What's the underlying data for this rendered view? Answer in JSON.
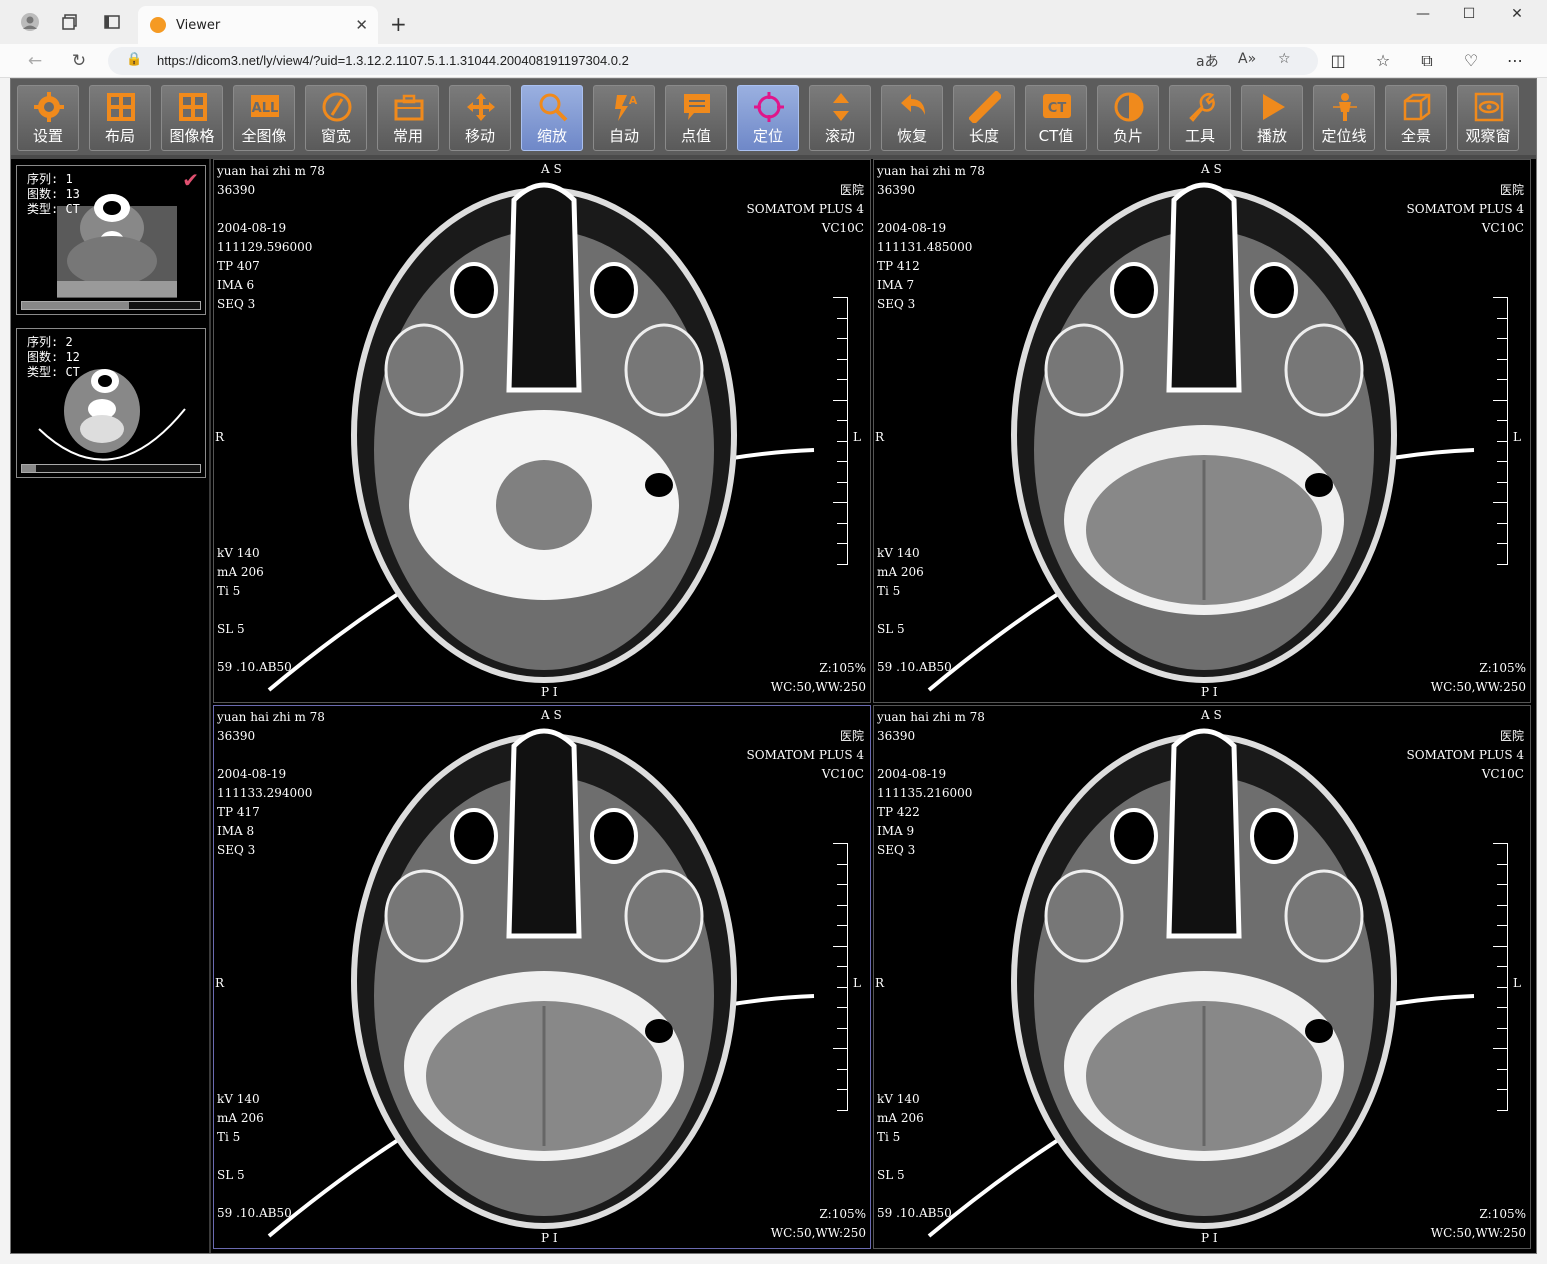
{
  "browser": {
    "tab_title": "Viewer",
    "url": "https://dicom3.net/ly/view4/?uid=1.3.12.2.1107.5.1.1.31044.200408191197304.0.2"
  },
  "toolbar": [
    {
      "label": "设置",
      "icon": "gear-icon"
    },
    {
      "label": "布局",
      "icon": "layout-grid-icon"
    },
    {
      "label": "图像格",
      "icon": "image-grid-icon"
    },
    {
      "label": "全图像",
      "icon": "all-images-icon"
    },
    {
      "label": "窗宽",
      "icon": "window-width-icon"
    },
    {
      "label": "常用",
      "icon": "toolbox-icon"
    },
    {
      "label": "移动",
      "icon": "move-icon"
    },
    {
      "label": "缩放",
      "icon": "zoom-icon",
      "active": true
    },
    {
      "label": "自动",
      "icon": "auto-icon"
    },
    {
      "label": "点值",
      "icon": "point-value-icon"
    },
    {
      "label": "定位",
      "icon": "crosshair-icon",
      "active": true
    },
    {
      "label": "滚动",
      "icon": "scroll-icon"
    },
    {
      "label": "恢复",
      "icon": "undo-icon"
    },
    {
      "label": "长度",
      "icon": "ruler-icon"
    },
    {
      "label": "CT值",
      "icon": "ct-value-icon"
    },
    {
      "label": "负片",
      "icon": "invert-icon"
    },
    {
      "label": "工具",
      "icon": "wrench-icon"
    },
    {
      "label": "播放",
      "icon": "play-icon"
    },
    {
      "label": "定位线",
      "icon": "reference-line-icon"
    },
    {
      "label": "全景",
      "icon": "cube-icon"
    },
    {
      "label": "观察窗",
      "icon": "eye-window-icon"
    }
  ],
  "series": [
    {
      "line1": "序列: 1",
      "line2": "图数: 13",
      "line3": "类型: CT",
      "progress": 0.6,
      "selected": true
    },
    {
      "line1": "序列: 2",
      "line2": "图数: 12",
      "line3": "类型: CT",
      "progress": 0.08,
      "selected": false
    }
  ],
  "viewports": [
    {
      "patient": "yuan hai zhi m 78",
      "id": "36390",
      "date": "2004-08-19",
      "time": "111129.596000",
      "tp": "TP 407",
      "ima": "IMA 6",
      "seq": "SEQ 3",
      "hospital": "医院",
      "scanner": "SOMATOM PLUS 4",
      "code": "VC10C",
      "kv": "kV 140",
      "ma": "mA 206",
      "ti": "Ti 5",
      "sl": "SL 5",
      "kernel": "59 .10.AB50",
      "zoom": "Z:105%",
      "window": "WC:50,WW:250",
      "top": "A S",
      "bottom": "P I",
      "left": "R",
      "right": "L"
    },
    {
      "patient": "yuan hai zhi m 78",
      "id": "36390",
      "date": "2004-08-19",
      "time": "111131.485000",
      "tp": "TP 412",
      "ima": "IMA 7",
      "seq": "SEQ 3",
      "hospital": "医院",
      "scanner": "SOMATOM PLUS 4",
      "code": "VC10C",
      "kv": "kV 140",
      "ma": "mA 206",
      "ti": "Ti 5",
      "sl": "SL 5",
      "kernel": "59 .10.AB50",
      "zoom": "Z:105%",
      "window": "WC:50,WW:250",
      "top": "A S",
      "bottom": "P I",
      "left": "R",
      "right": "L"
    },
    {
      "patient": "yuan hai zhi m 78",
      "id": "36390",
      "date": "2004-08-19",
      "time": "111133.294000",
      "tp": "TP 417",
      "ima": "IMA 8",
      "seq": "SEQ 3",
      "hospital": "医院",
      "scanner": "SOMATOM PLUS 4",
      "code": "VC10C",
      "kv": "kV 140",
      "ma": "mA 206",
      "ti": "Ti 5",
      "sl": "SL 5",
      "kernel": "59 .10.AB50",
      "zoom": "Z:105%",
      "window": "WC:50,WW:250",
      "top": "A S",
      "bottom": "P I",
      "left": "R",
      "right": "L"
    },
    {
      "patient": "yuan hai zhi m 78",
      "id": "36390",
      "date": "2004-08-19",
      "time": "111135.216000",
      "tp": "TP 422",
      "ima": "IMA 9",
      "seq": "SEQ 3",
      "hospital": "医院",
      "scanner": "SOMATOM PLUS 4",
      "code": "VC10C",
      "kv": "kV 140",
      "ma": "mA 206",
      "ti": "Ti 5",
      "sl": "SL 5",
      "kernel": "59 .10.AB50",
      "zoom": "Z:105%",
      "window": "WC:50,WW:250",
      "top": "A S",
      "bottom": "P I",
      "left": "R",
      "right": "L"
    }
  ]
}
